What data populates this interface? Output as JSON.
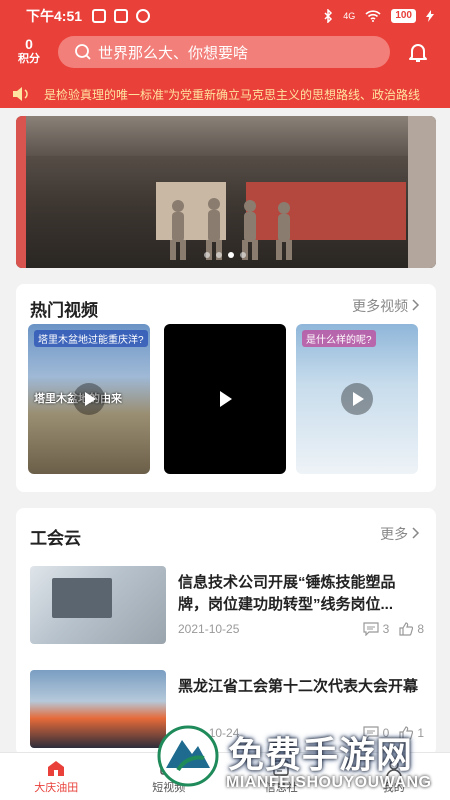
{
  "status_bar": {
    "time": "下午4:51",
    "network": "4G",
    "battery": "100"
  },
  "header": {
    "points_value": "0",
    "points_label": "积分",
    "search_placeholder": "世界那么大、你想要啥"
  },
  "marquee": {
    "text": "是检验真理的唯一标准”为党重新确立马克思主义的思想路线、政治路线"
  },
  "banner": {
    "dot_count": 4,
    "active_dot": 2
  },
  "hot_videos": {
    "title": "热门视频",
    "more_label": "更多视频",
    "videos": [
      {
        "caption": "塔里木盆地过能重庆洋?",
        "overlay_text": "塔里木盆地的由来"
      },
      {
        "caption": "",
        "overlay_text": ""
      },
      {
        "caption": "是什么样的呢?",
        "overlay_text": ""
      }
    ]
  },
  "union_cloud": {
    "title": "工会云",
    "more_label": "更多",
    "news": [
      {
        "title": "信息技术公司开展“锤炼技能塑品牌，岗位建功助转型”线务岗位...",
        "date": "2021-10-25",
        "comments": "3",
        "likes": "8"
      },
      {
        "title": "黑龙江省工会第十二次代表大会开幕",
        "date": "2021-10-24",
        "comments": "0",
        "likes": "1"
      }
    ]
  },
  "bottom_nav": [
    {
      "label": "大庆油田",
      "active": true
    },
    {
      "label": "短视频",
      "active": false
    },
    {
      "label": "信息社",
      "active": false
    },
    {
      "label": "我的",
      "active": false
    }
  ],
  "watermark": {
    "title": "免费手游网",
    "subtitle": "MIANFEISHOUYOUWANG"
  },
  "colors": {
    "brand_red": "#e9403a",
    "marquee_text": "#ffe3a0"
  }
}
